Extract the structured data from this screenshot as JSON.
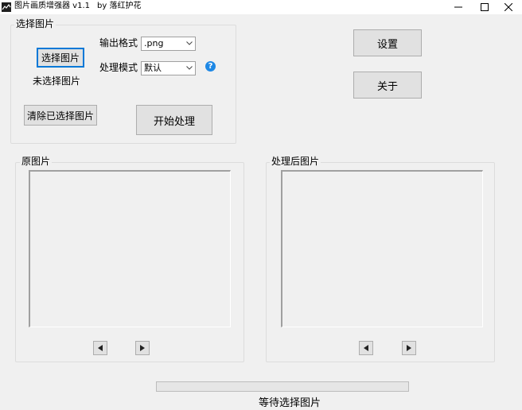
{
  "window": {
    "title": "图片画质增强器 v1.1",
    "author": "by 落红护花"
  },
  "select_group": {
    "title": "选择图片",
    "select_button": "选择图片",
    "selected_status": "未选择图片",
    "clear_button": "清除已选择图片",
    "output_format_label": "输出格式",
    "output_format_value": ".png",
    "process_mode_label": "处理模式",
    "process_mode_value": "默认",
    "help": "?",
    "start_button": "开始处理"
  },
  "side_buttons": {
    "settings": "设置",
    "about": "关于"
  },
  "original_group": {
    "title": "原图片"
  },
  "processed_group": {
    "title": "处理后图片"
  },
  "progress": {
    "value": 0
  },
  "status_text": "等待选择图片"
}
